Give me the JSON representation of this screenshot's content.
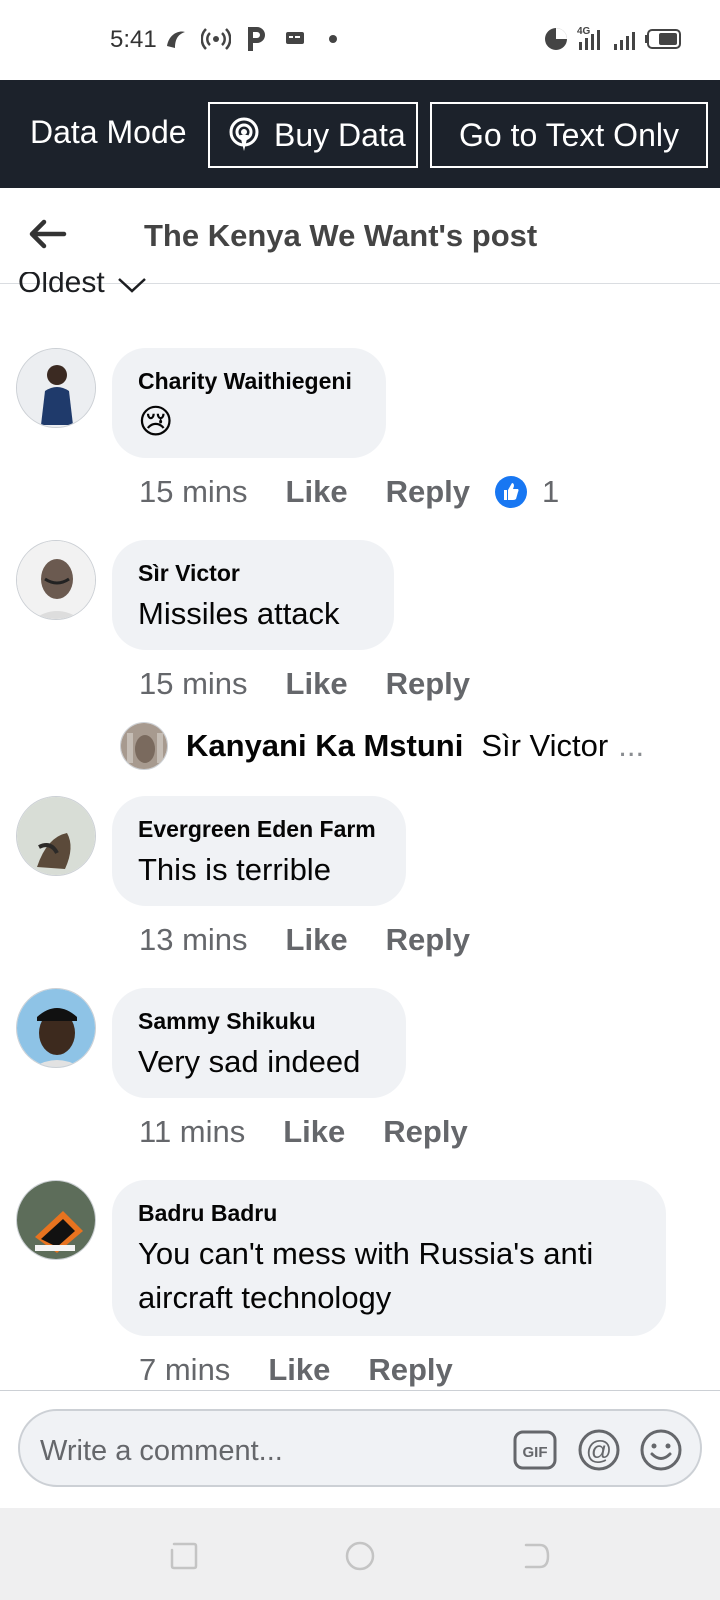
{
  "status_bar": {
    "time": "5:41"
  },
  "data_bar": {
    "mode_label": "Data Mode",
    "buy_data_label": "Buy Data",
    "text_only_label": "Go to Text Only"
  },
  "header": {
    "title": "The Kenya We Want's post"
  },
  "sort": {
    "label": "Oldest"
  },
  "comments": [
    {
      "name": "Charity Waithiegeni",
      "text": "😢",
      "time": "15 mins",
      "like": "Like",
      "reply": "Reply",
      "reaction_count": "1"
    },
    {
      "name": "Sìr Victor",
      "text": "Missiles attack",
      "time": "15 mins",
      "like": "Like",
      "reply": "Reply"
    },
    {
      "name": "Evergreen Eden Farm",
      "text": "This is terrible",
      "time": "13 mins",
      "like": "Like",
      "reply": "Reply"
    },
    {
      "name": "Sammy Shikuku",
      "text": "Very sad indeed",
      "time": "11 mins",
      "like": "Like",
      "reply": "Reply"
    },
    {
      "name": "Badru Badru",
      "text": "You can't mess with Russia's anti aircraft technology",
      "time": "7 mins",
      "like": "Like",
      "reply": "Reply"
    }
  ],
  "reply_preview": {
    "name": "Kanyani Ka Mstuni",
    "text": "Sìr Victor",
    "ellipsis": "..."
  },
  "composer": {
    "placeholder": "Write a comment...",
    "gif_label": "GIF"
  },
  "colors": {
    "data_bar_bg": "#1c222b",
    "bubble_bg": "#f0f2f5",
    "like_blue": "#1877f2"
  }
}
